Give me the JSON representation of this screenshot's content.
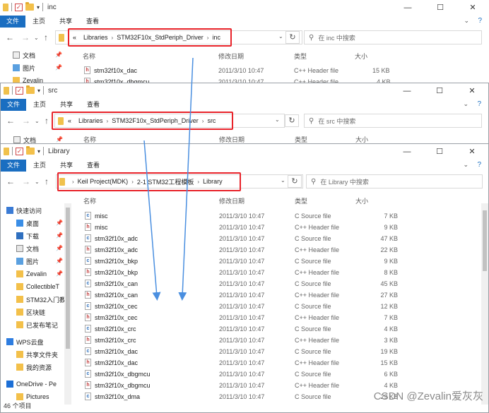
{
  "colors": {
    "file_tab": "#1a6ec1",
    "highlight": "#e8232a",
    "arrow": "#4a8fe0",
    "folder": "#f3c04a"
  },
  "ribbon": {
    "file": "文件",
    "home": "主页",
    "share": "共享",
    "view": "查看"
  },
  "columns": {
    "name": "名称",
    "date": "修改日期",
    "type": "类型",
    "size": "大小"
  },
  "window_controls": {
    "minimize": "—",
    "maximize": "☐",
    "close": "✕"
  },
  "win1": {
    "title": "inc",
    "path_prefix": "«",
    "path": [
      "Libraries",
      "STM32F10x_StdPeriph_Driver",
      "inc"
    ],
    "search_placeholder": "在 inc 中搜索",
    "sidebar": [
      {
        "label": "文档",
        "icon": "document-icon"
      },
      {
        "label": "图片",
        "icon": "pictures-icon"
      },
      {
        "label": "Zevalin",
        "icon": "folder-icon"
      }
    ],
    "rows": [
      {
        "icon": "h",
        "name": "stm32f10x_dac",
        "date": "2011/3/10 10:47",
        "type": "C++ Header file",
        "size": "15 KB"
      },
      {
        "icon": "h",
        "name": "stm32f10x_dbgmcu",
        "date": "2011/3/10 10:47",
        "type": "C++ Header file",
        "size": "4 KB"
      }
    ]
  },
  "win2": {
    "title": "src",
    "path_prefix": "«",
    "path": [
      "Libraries",
      "STM32F10x_StdPeriph_Driver",
      "src"
    ],
    "search_placeholder": "在 src 中搜索",
    "sidebar": [
      {
        "label": "文档",
        "icon": "document-icon"
      }
    ]
  },
  "win3": {
    "title": "Library",
    "path": [
      "Keil Project(MDK)",
      "2-1 STM32工程模板",
      "Library"
    ],
    "search_placeholder": "在 Library 中搜索",
    "sidebar": [
      {
        "label": "快速访问",
        "icon": "star-icon",
        "pinned": false
      },
      {
        "label": "桌面",
        "icon": "desktop-icon",
        "pinned": true
      },
      {
        "label": "下载",
        "icon": "download-icon",
        "pinned": true
      },
      {
        "label": "文档",
        "icon": "document-icon",
        "pinned": true
      },
      {
        "label": "图片",
        "icon": "pictures-icon",
        "pinned": true
      },
      {
        "label": "Zevalin",
        "icon": "folder-icon",
        "pinned": true
      },
      {
        "label": "CollectibleT",
        "icon": "folder-icon",
        "pinned": false
      },
      {
        "label": "STM32入门教",
        "icon": "folder-icon",
        "pinned": false
      },
      {
        "label": "区块链",
        "icon": "folder-icon",
        "pinned": false
      },
      {
        "label": "已发布笔记",
        "icon": "folder-icon",
        "pinned": false
      },
      {
        "label": "WPS云盘",
        "icon": "cloud-icon",
        "pinned": false
      },
      {
        "label": "共享文件夹",
        "icon": "folder-icon",
        "pinned": false
      },
      {
        "label": "我的资源",
        "icon": "folder-icon",
        "pinned": false
      },
      {
        "label": "OneDrive - Pe",
        "icon": "onedrive-icon",
        "pinned": false
      },
      {
        "label": "Pictures",
        "icon": "folder-icon",
        "pinned": false
      }
    ],
    "rows": [
      {
        "icon": "c",
        "name": "misc",
        "date": "2011/3/10 10:47",
        "type": "C Source file",
        "size": "7 KB"
      },
      {
        "icon": "h",
        "name": "misc",
        "date": "2011/3/10 10:47",
        "type": "C++ Header file",
        "size": "9 KB"
      },
      {
        "icon": "c",
        "name": "stm32f10x_adc",
        "date": "2011/3/10 10:47",
        "type": "C Source file",
        "size": "47 KB"
      },
      {
        "icon": "h",
        "name": "stm32f10x_adc",
        "date": "2011/3/10 10:47",
        "type": "C++ Header file",
        "size": "22 KB"
      },
      {
        "icon": "c",
        "name": "stm32f10x_bkp",
        "date": "2011/3/10 10:47",
        "type": "C Source file",
        "size": "9 KB"
      },
      {
        "icon": "h",
        "name": "stm32f10x_bkp",
        "date": "2011/3/10 10:47",
        "type": "C++ Header file",
        "size": "8 KB"
      },
      {
        "icon": "c",
        "name": "stm32f10x_can",
        "date": "2011/3/10 10:47",
        "type": "C Source file",
        "size": "45 KB"
      },
      {
        "icon": "h",
        "name": "stm32f10x_can",
        "date": "2011/3/10 10:47",
        "type": "C++ Header file",
        "size": "27 KB"
      },
      {
        "icon": "c",
        "name": "stm32f10x_cec",
        "date": "2011/3/10 10:47",
        "type": "C Source file",
        "size": "12 KB"
      },
      {
        "icon": "h",
        "name": "stm32f10x_cec",
        "date": "2011/3/10 10:47",
        "type": "C++ Header file",
        "size": "7 KB"
      },
      {
        "icon": "c",
        "name": "stm32f10x_crc",
        "date": "2011/3/10 10:47",
        "type": "C Source file",
        "size": "4 KB"
      },
      {
        "icon": "h",
        "name": "stm32f10x_crc",
        "date": "2011/3/10 10:47",
        "type": "C++ Header file",
        "size": "3 KB"
      },
      {
        "icon": "c",
        "name": "stm32f10x_dac",
        "date": "2011/3/10 10:47",
        "type": "C Source file",
        "size": "19 KB"
      },
      {
        "icon": "h",
        "name": "stm32f10x_dac",
        "date": "2011/3/10 10:47",
        "type": "C++ Header file",
        "size": "15 KB"
      },
      {
        "icon": "c",
        "name": "stm32f10x_dbgmcu",
        "date": "2011/3/10 10:47",
        "type": "C Source file",
        "size": "6 KB"
      },
      {
        "icon": "h",
        "name": "stm32f10x_dbgmcu",
        "date": "2011/3/10 10:47",
        "type": "C++ Header file",
        "size": "4 KB"
      },
      {
        "icon": "c",
        "name": "stm32f10x_dma",
        "date": "2011/3/10 10:47",
        "type": "C Source file",
        "size": "29 KB"
      }
    ],
    "status": "46 个项目"
  },
  "watermark": "CSDN @Zevalin爱灰灰"
}
